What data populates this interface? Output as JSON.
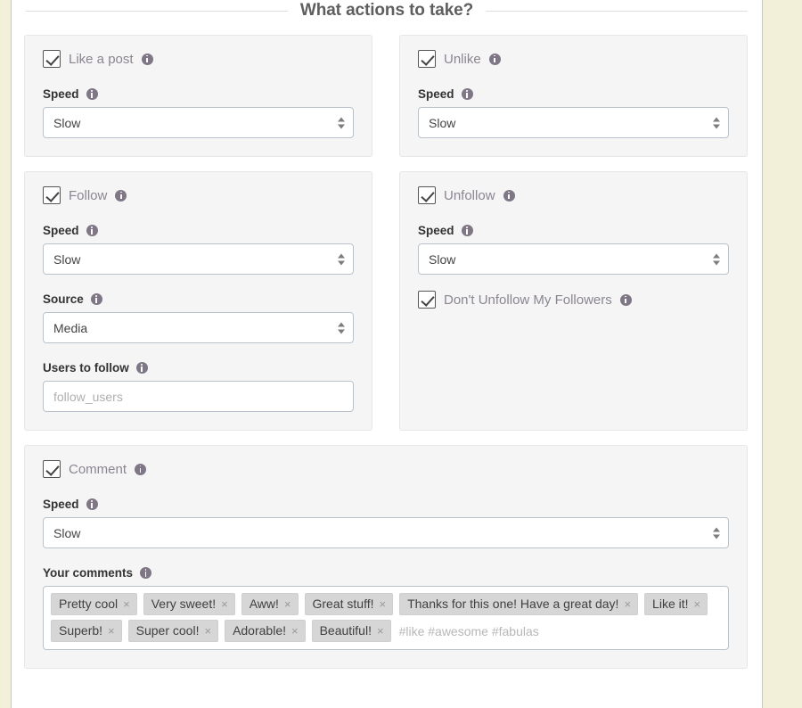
{
  "section": {
    "title": "What actions to take?"
  },
  "icons": {
    "info": "info-icon",
    "check": "check-icon",
    "spinner": "select-spinner-icon",
    "remove": "remove-tag-icon"
  },
  "labels": {
    "speed": "Speed",
    "source": "Source",
    "users_to_follow": "Users to follow",
    "your_comments": "Your comments"
  },
  "panels": [
    {
      "id": "like-a-post",
      "checkbox_label": "Like a post",
      "checked": true,
      "speed_value": "Slow"
    },
    {
      "id": "unlike",
      "checkbox_label": "Unlike",
      "checked": true,
      "speed_value": "Slow"
    },
    {
      "id": "follow",
      "checkbox_label": "Follow",
      "checked": true,
      "speed_value": "Slow",
      "source_value": "Media",
      "users_placeholder": "follow_users"
    },
    {
      "id": "unfollow",
      "checkbox_label": "Unfollow",
      "checked": true,
      "speed_value": "Slow",
      "sub_checkbox_label": "Don't Unfollow My Followers",
      "sub_checked": true
    },
    {
      "id": "comment",
      "checkbox_label": "Comment",
      "checked": true,
      "speed_value": "Slow",
      "comments_placeholder": "#like #awesome #fabulas",
      "comment_tags": [
        "Pretty cool",
        "Very sweet!",
        "Aww!",
        "Great stuff!",
        "Thanks for this one! Have a great day!",
        "Like it!",
        "Superb!",
        "Super cool!",
        "Adorable!",
        "Beautiful!"
      ]
    }
  ],
  "tag_remove_glyph": "×",
  "colors": {
    "page_background": "#f2f0d8",
    "container_background": "#ffffff",
    "panel_background": "#f5f5f5",
    "panel_border": "#e7e7e7",
    "info_icon": "#7f7686",
    "checkbox_label": "#8b8591",
    "field_label": "#333333",
    "input_border": "#b9c2cc",
    "tag_background": "#d6d6d6",
    "legend_text": "#5e5e5e"
  }
}
